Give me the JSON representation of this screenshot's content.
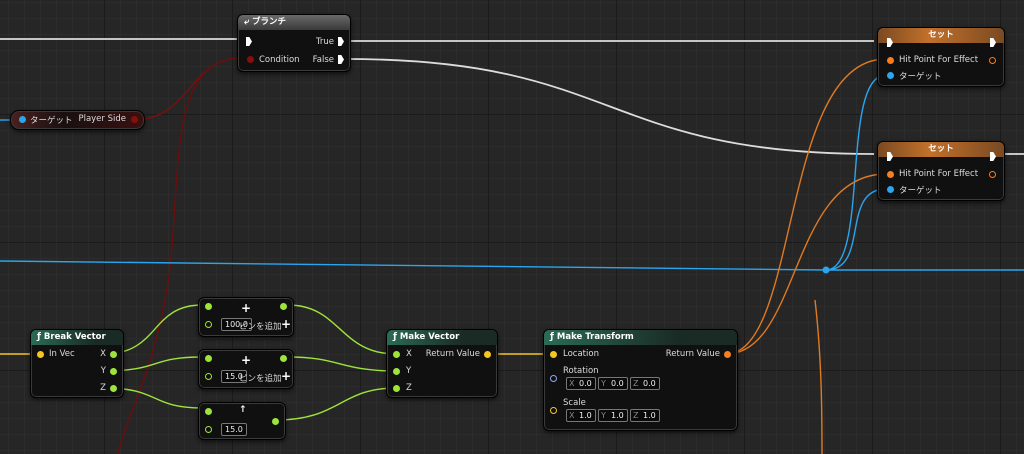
{
  "branch": {
    "title": "ブランチ",
    "condition": "Condition",
    "true_label": "True",
    "false_label": "False"
  },
  "getter": {
    "target": "ターゲット",
    "output": "Player Side"
  },
  "set_top": {
    "title": "セット",
    "param": "Hit Point For Effect",
    "target": "ターゲット"
  },
  "set_bottom": {
    "title": "セット",
    "param": "Hit Point For Effect",
    "target": "ターゲット"
  },
  "break_vector": {
    "title": "Break Vector",
    "input": "In Vec",
    "x": "X",
    "y": "Y",
    "z": "Z"
  },
  "add_x": {
    "value": "100.0",
    "add_pin": "ピンを追加"
  },
  "add_y": {
    "value": "15.0",
    "add_pin": "ピンを追加"
  },
  "add_z": {
    "value": "15.0"
  },
  "make_vector": {
    "title": "Make Vector",
    "x": "X",
    "y": "Y",
    "z": "Z",
    "output": "Return Value"
  },
  "make_transform": {
    "title": "Make Transform",
    "location": "Location",
    "rotation": "Rotation",
    "scale": "Scale",
    "output": "Return Value",
    "rotation_values": {
      "x": "0.0",
      "y": "0.0",
      "z": "0.0"
    },
    "scale_values": {
      "x": "1.0",
      "y": "1.0",
      "z": "1.0"
    },
    "axis_x": "X",
    "axis_y": "Y",
    "axis_z": "Z"
  },
  "colors": {
    "exec": "#ffffff",
    "bool": "#8a0d0d",
    "object": "#2aa6f0",
    "float": "#9ee33a",
    "vector": "#f4c620",
    "transform": "#f57d22"
  }
}
